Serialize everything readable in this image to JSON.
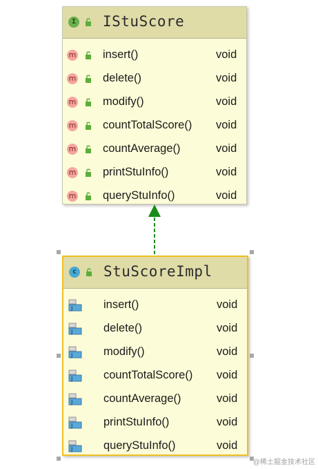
{
  "diagram": {
    "interface": {
      "kind": "I",
      "name": "IStuScore",
      "methods": [
        {
          "badge": "m",
          "name": "insert()",
          "type": "void"
        },
        {
          "badge": "m",
          "name": "delete()",
          "type": "void"
        },
        {
          "badge": "m",
          "name": "modify()",
          "type": "void"
        },
        {
          "badge": "m",
          "name": "countTotalScore()",
          "type": "void"
        },
        {
          "badge": "m",
          "name": "countAverage()",
          "type": "void"
        },
        {
          "badge": "m",
          "name": "printStuInfo()",
          "type": "void"
        },
        {
          "badge": "m",
          "name": "queryStuInfo()",
          "type": "void"
        }
      ]
    },
    "implementation": {
      "kind": "c",
      "name": "StuScoreImpl",
      "methods": [
        {
          "name": "insert()",
          "type": "void"
        },
        {
          "name": "delete()",
          "type": "void"
        },
        {
          "name": "modify()",
          "type": "void"
        },
        {
          "name": "countTotalScore()",
          "type": "void"
        },
        {
          "name": "countAverage()",
          "type": "void"
        },
        {
          "name": "printStuInfo()",
          "type": "void"
        },
        {
          "name": "queryStuInfo()",
          "type": "void"
        }
      ]
    },
    "relation": {
      "type": "implements",
      "color": "#1a8a1a"
    }
  },
  "colors": {
    "box_fill": "#fdfcd8",
    "header_fill": "#dfdca8",
    "selection": "#f0c020",
    "lock": "#5cae3a"
  },
  "watermark": "@稀土掘金技术社区"
}
